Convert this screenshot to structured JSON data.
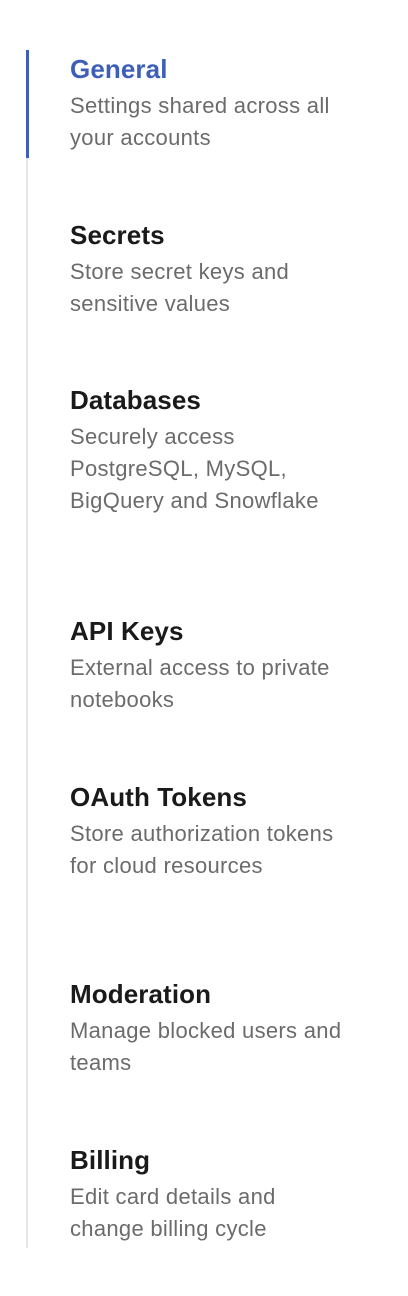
{
  "nav": {
    "items": [
      {
        "id": "general",
        "title": "General",
        "description": "Settings shared across all your accounts",
        "active": true
      },
      {
        "id": "secrets",
        "title": "Secrets",
        "description": "Store secret keys and sensitive values",
        "active": false
      },
      {
        "id": "databases",
        "title": "Databases",
        "description": "Securely access PostgreSQL, MySQL, BigQuery and Snowflake",
        "active": false
      },
      {
        "id": "api-keys",
        "title": "API Keys",
        "description": "External access to private notebooks",
        "active": false
      },
      {
        "id": "oauth-tokens",
        "title": "OAuth Tokens",
        "description": "Store authorization tokens for cloud resources",
        "active": false
      },
      {
        "id": "moderation",
        "title": "Moderation",
        "description": "Manage blocked users and teams",
        "active": false
      },
      {
        "id": "billing",
        "title": "Billing",
        "description": "Edit card details and change billing cycle",
        "active": false
      }
    ],
    "accent_color": "#3d5fb8"
  }
}
